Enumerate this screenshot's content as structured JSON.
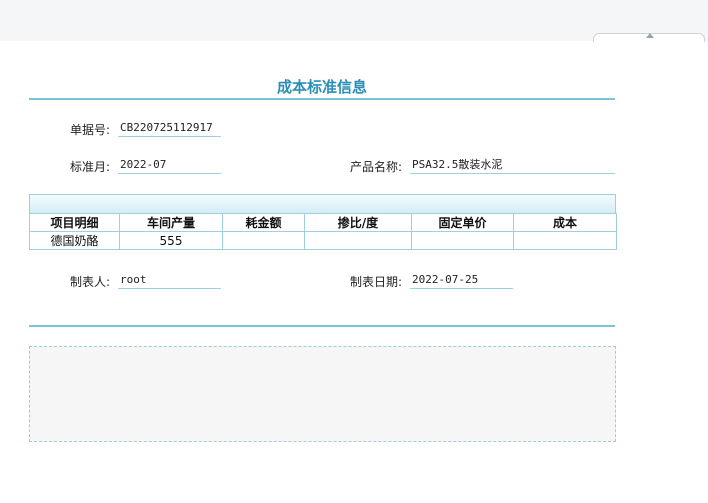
{
  "form": {
    "title": "成本标准信息",
    "doc_no": {
      "label": "单据号:",
      "value": "CB220725112917"
    },
    "std_month": {
      "label": "标准月:",
      "value": "2022-07"
    },
    "product_name": {
      "label": "产品名称:",
      "value": "PSA32.5散装水泥"
    },
    "creator": {
      "label": "制表人:",
      "value": "root"
    },
    "create_date": {
      "label": "制表日期:",
      "value": "2022-07-25"
    }
  },
  "grid": {
    "columns": [
      "项目明细",
      "车间产量",
      "耗金额",
      "掺比/度",
      "固定单价",
      "成本"
    ],
    "rows": [
      [
        "德国奶酪",
        "555",
        "",
        "",
        "",
        ""
      ]
    ]
  },
  "colors": {
    "accent": "#2a8fb5",
    "rule": "#7cc3dc",
    "border": "#9fd0e2"
  }
}
